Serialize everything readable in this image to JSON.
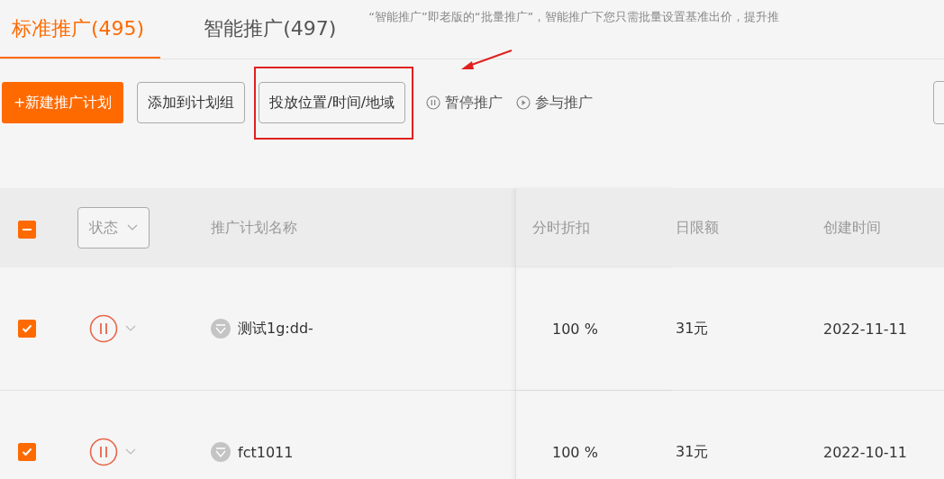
{
  "tabs": [
    {
      "label": "标准推广(495)",
      "selected": true
    },
    {
      "label": "智能推广(497)",
      "selected": false
    }
  ],
  "notice": "“智能推广”即老版的“批量推广”，智能推广下您只需批量设置基准出价，提升推",
  "toolbar": {
    "primary": "+新建推广计划",
    "buttons": [
      {
        "label": "添加到计划组",
        "highlighted": false
      },
      {
        "label": "投放位置/时间/地域",
        "highlighted": true
      }
    ],
    "actions": [
      {
        "kind": "pause",
        "label": "暂停推广"
      },
      {
        "kind": "play",
        "label": "参与推广"
      }
    ]
  },
  "table": {
    "indeterminate": true,
    "status_filter": "状态",
    "columns": [
      "推广计划名称",
      "分时折扣",
      "日限额",
      "创建时间"
    ],
    "rows": [
      {
        "checked": true,
        "paused": true,
        "name": "测试1g:dd-",
        "discount": "100 %",
        "limit": "31元",
        "created": "2022-11-11"
      },
      {
        "checked": true,
        "paused": true,
        "name": "fct1011",
        "discount": "100 %",
        "limit": "31元",
        "created": "2022-10-11"
      }
    ]
  }
}
